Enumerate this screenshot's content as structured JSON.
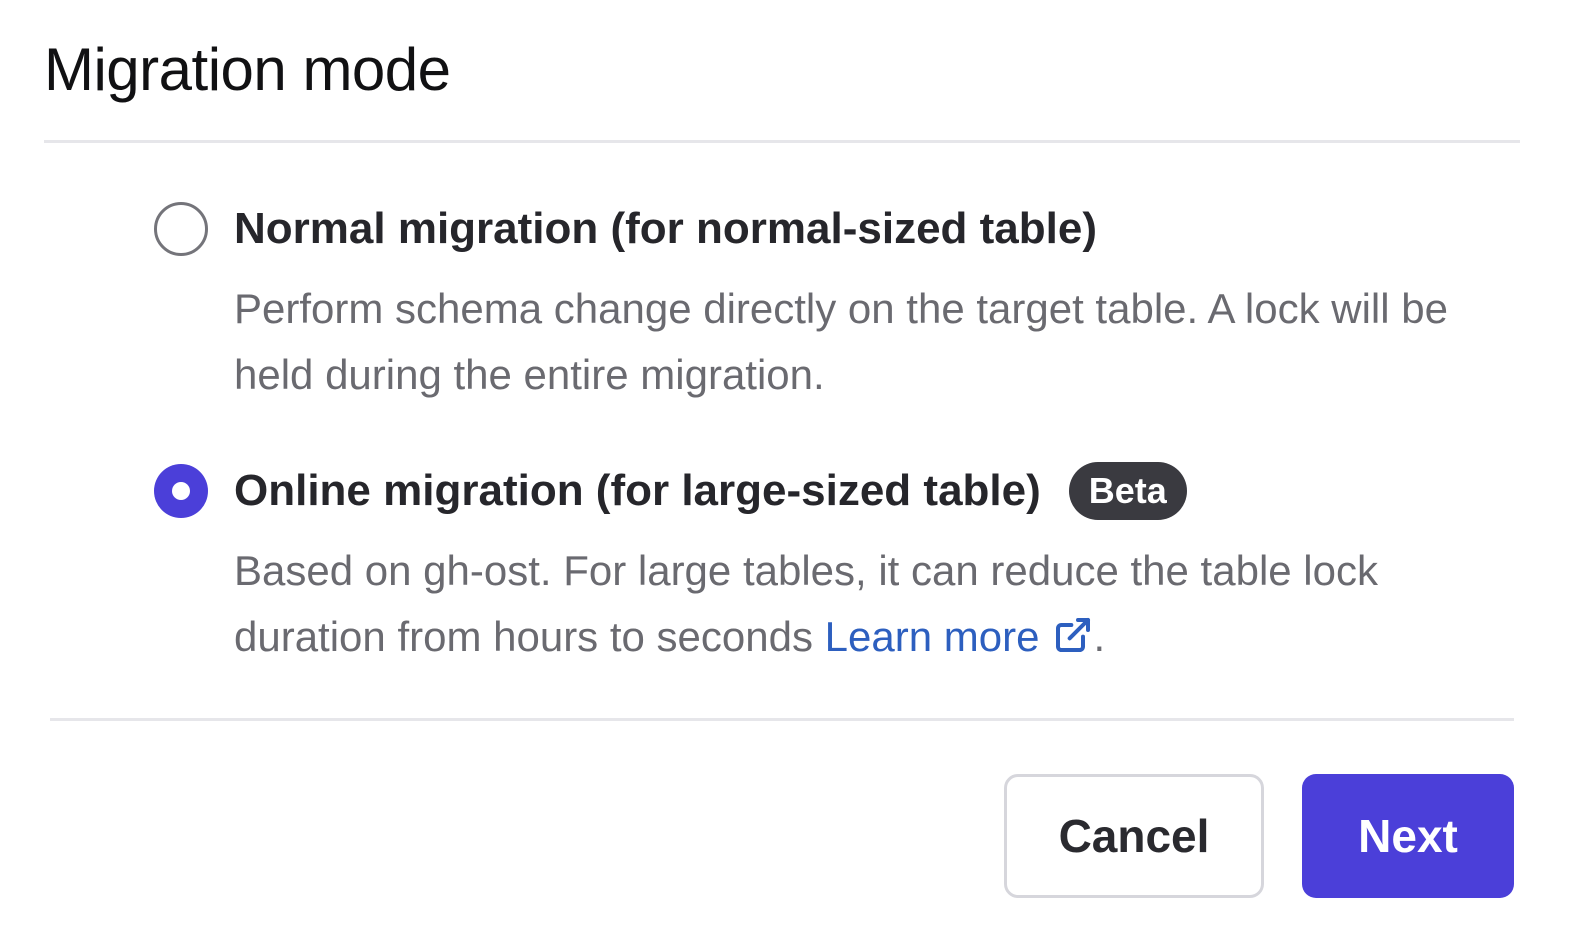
{
  "dialog": {
    "title": "Migration mode"
  },
  "options": [
    {
      "label": "Normal migration (for normal-sized table)",
      "description": "Perform schema change directly on the target table. A lock will be held during the entire migration.",
      "selected": false
    },
    {
      "label": "Online migration (for large-sized table)",
      "badge": "Beta",
      "description": "Based on gh-ost. For large tables, it can reduce the table lock duration from hours to seconds",
      "link_text": "Learn more",
      "link_icon": "external-link-icon",
      "trailing": ".",
      "selected": true
    }
  ],
  "footer": {
    "cancel_label": "Cancel",
    "next_label": "Next"
  },
  "colors": {
    "accent": "#4b3fd9",
    "link": "#2d5fbf",
    "badge_bg": "#3a3a40"
  }
}
